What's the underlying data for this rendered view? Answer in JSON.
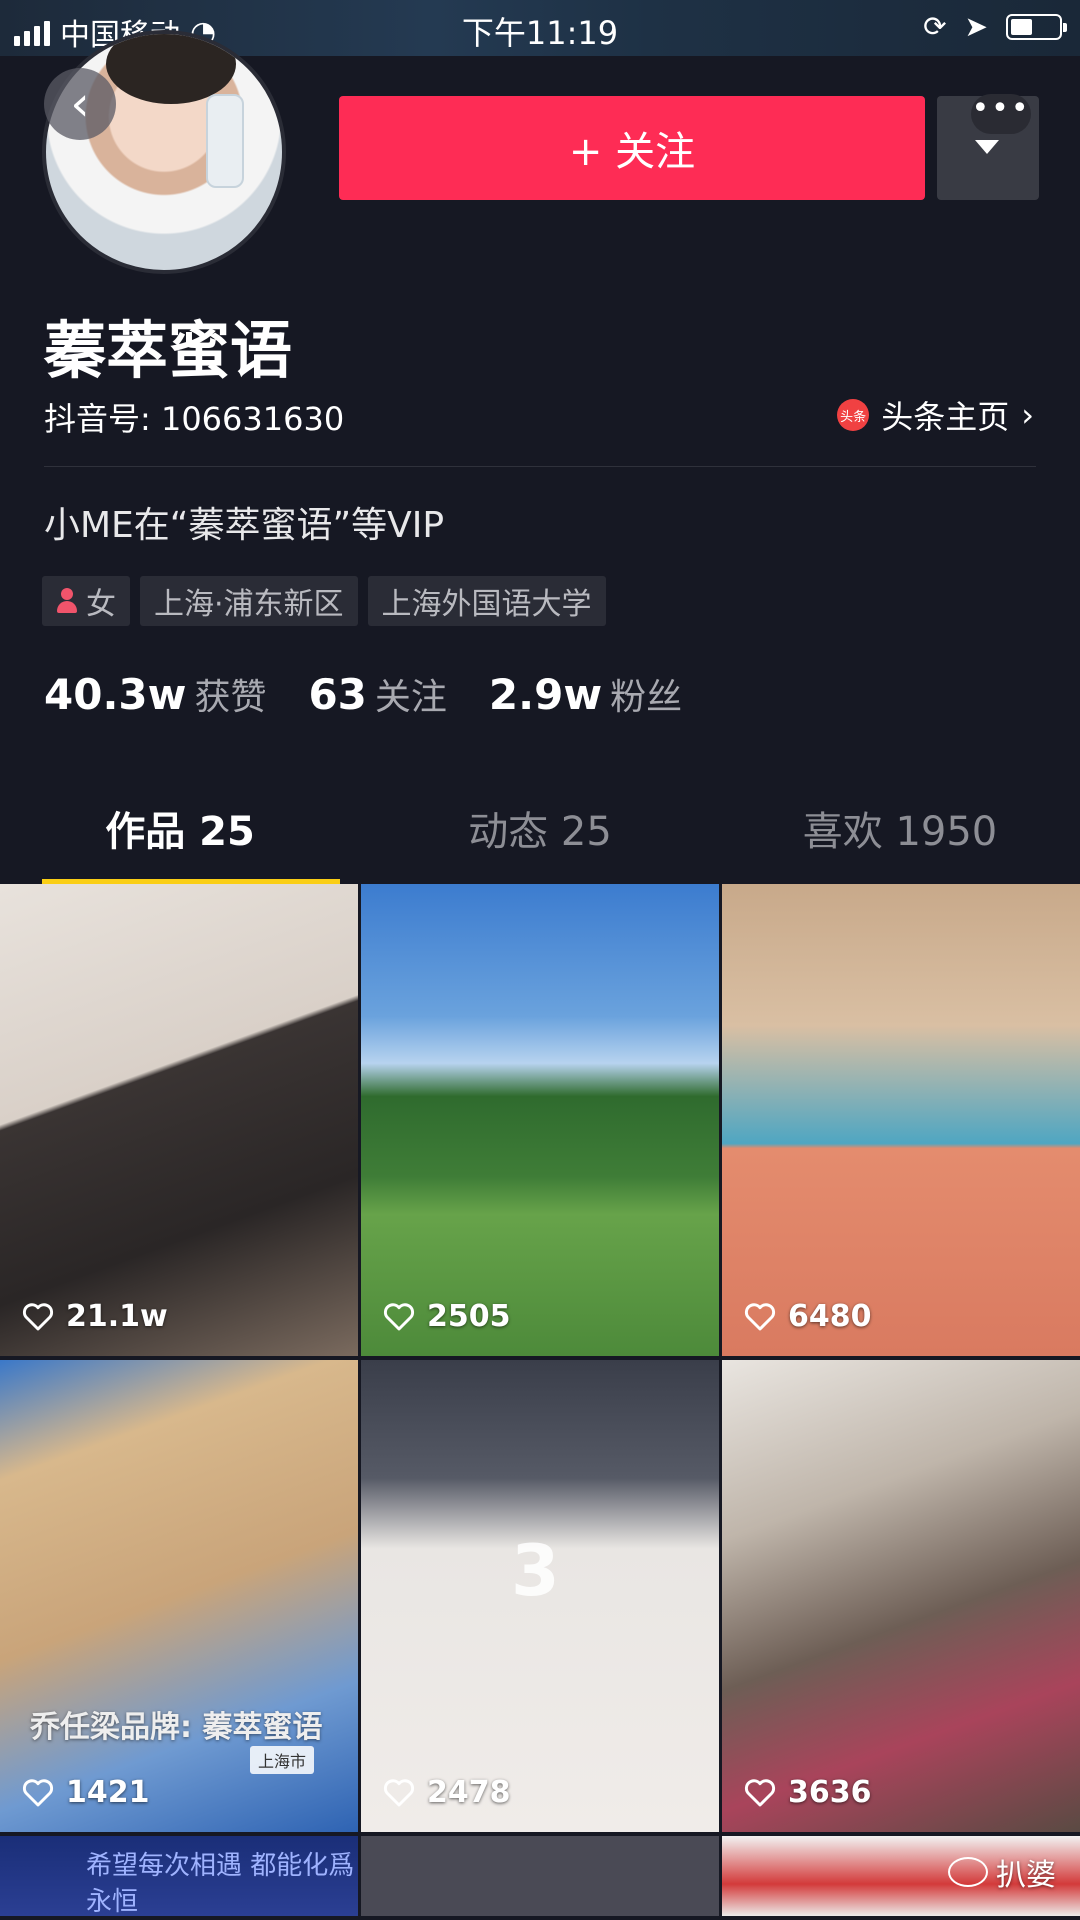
{
  "status_bar": {
    "carrier": "中国移动",
    "time": "下午11:19",
    "battery_level": 0.45
  },
  "header": {
    "back_icon": "‹",
    "follow_label": "+ 关注",
    "more_icon": "•••"
  },
  "profile": {
    "name": "蓁萃蜜语",
    "douyin_id": "抖音号: 106631630",
    "toutiao_icon_text": "头条",
    "toutiao_label": "头条主页",
    "bio": "小ME在“蓁萃蜜语”等VIP",
    "tags": {
      "gender": "女",
      "location": "上海·浦东新区",
      "school": "上海外国语大学"
    },
    "stats": {
      "likes_num": "40.3w",
      "likes_label": "获赞",
      "following_num": "63",
      "following_label": "关注",
      "fans_num": "2.9w",
      "fans_label": "粉丝"
    }
  },
  "tabs": {
    "works": "作品 25",
    "activity": "动态 25",
    "liked": "喜欢 1950"
  },
  "videos": [
    {
      "likes": "21.1w"
    },
    {
      "likes": "2505"
    },
    {
      "likes": "6480"
    },
    {
      "likes": "1421",
      "overlay": "乔任梁品牌: 蓁萃蜜语",
      "overlay_sub": "上海市"
    },
    {
      "likes": "2478",
      "overlay": "3"
    },
    {
      "likes": "3636"
    },
    {
      "overlay": "希望每次相遇 都能化爲永恒"
    }
  ],
  "watermark": "扒婆",
  "colors": {
    "background": "#161823",
    "follow_button": "#fe2c55",
    "tab_indicator": "#face15"
  }
}
